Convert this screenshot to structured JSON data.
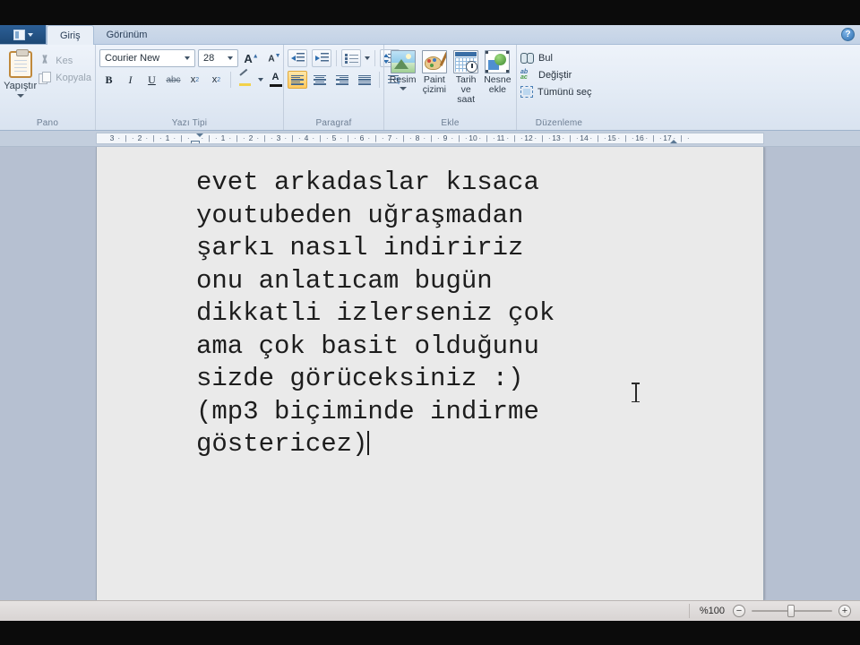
{
  "window": {
    "qat": {
      "doc_icon": "document-icon",
      "dropdown_icon": "chevron-down-icon"
    },
    "help_label": "?"
  },
  "tabs": [
    {
      "label": "Giriş",
      "active": true
    },
    {
      "label": "Görünüm",
      "active": false
    }
  ],
  "ribbon": {
    "groups": [
      {
        "title": "Pano",
        "paste": {
          "label": "Yapıştır",
          "icon": "clipboard-icon"
        },
        "commands": [
          {
            "label": "Kes",
            "icon": "scissors-icon"
          },
          {
            "label": "Kopyala",
            "icon": "copy-icon"
          }
        ]
      },
      {
        "title": "Yazı Tipi",
        "font_name": "Courier New",
        "font_size": "28",
        "grow_label": "A",
        "shrink_label": "A",
        "bold_label": "B",
        "italic_label": "I",
        "underline_label": "U",
        "strike_label": "abc",
        "subscript_label": "x",
        "subscript_sub": "2",
        "superscript_label": "x",
        "superscript_sup": "2",
        "highlight_icon": "highlight-icon",
        "fontcolor_label": "A"
      },
      {
        "title": "Paragraf",
        "buttons": [
          "decrease-indent",
          "increase-indent",
          "bullets",
          "line-spacing",
          "align-left",
          "align-center",
          "align-right",
          "justify",
          "text-direction"
        ],
        "active_alignment": "align-left"
      },
      {
        "title": "Ekle",
        "items": [
          {
            "label_line1": "Resim",
            "label_line2": "",
            "icon": "picture-icon",
            "has_caret": true
          },
          {
            "label_line1": "Paint",
            "label_line2": "çizimi",
            "icon": "paint-drawing-icon",
            "has_caret": false
          },
          {
            "label_line1": "Tarih",
            "label_line2": "ve saat",
            "icon": "date-time-icon",
            "has_caret": false
          },
          {
            "label_line1": "Nesne",
            "label_line2": "ekle",
            "icon": "insert-object-icon",
            "has_caret": false
          }
        ]
      },
      {
        "title": "Düzenleme",
        "commands": [
          {
            "label": "Bul",
            "icon": "find-icon"
          },
          {
            "label": "Değiştir",
            "icon": "replace-icon"
          },
          {
            "label": "Tümünü seç",
            "icon": "select-all-icon"
          }
        ]
      }
    ]
  },
  "ruler": {
    "left_labels": [
      "3",
      "2",
      "1"
    ],
    "right_labels": [
      "1",
      "2",
      "3",
      "4",
      "5",
      "6",
      "7",
      "8",
      "9",
      "10",
      "11",
      "12",
      "13",
      "14",
      "15",
      "16",
      "17"
    ],
    "indent_marker": "first-line-indent-marker",
    "right_margin_marker": "right-indent-marker"
  },
  "document": {
    "lines": [
      "evet arkadaslar kısaca",
      "youtubeden uğraşmadan",
      "şarkı nasıl indiririz",
      "onu anlatıcam bugün",
      "dikkatli izlerseniz çok",
      "ama çok basit olduğunu",
      "sizde görüceksiniz :)",
      "(mp3 biçiminde indirme",
      "göstericez)"
    ],
    "caret_after_line": 8
  },
  "statusbar": {
    "zoom_percent": "%100",
    "zoom_out_label": "−",
    "zoom_in_label": "+"
  },
  "colors": {
    "ribbon_bg": "#e7eef7",
    "tab_active_bg": "#e9eff7",
    "qat_blue": "#2c5f96",
    "canvas_bg": "#b6c0d1",
    "page_bg": "#eaeaea",
    "accent_orange": "#ffc95e",
    "text": "#1d1d1d"
  }
}
